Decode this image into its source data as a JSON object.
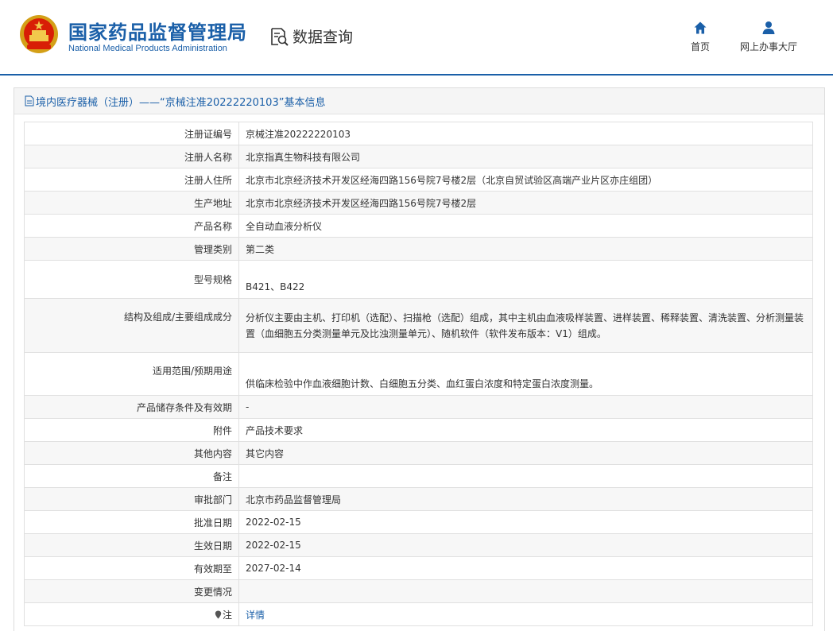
{
  "header": {
    "title_cn": "国家药品监督管理局",
    "title_en": "National Medical Products Administration",
    "query_label": "数据查询",
    "nav": [
      {
        "label": "首页",
        "icon": "home-icon"
      },
      {
        "label": "网上办事大厅",
        "icon": "user-icon"
      }
    ]
  },
  "panel": {
    "title": "境内医疗器械（注册）——“京械注准20222220103”基本信息"
  },
  "details": {
    "reg_no": {
      "label": "注册证编号",
      "value": "京械注准20222220103"
    },
    "registrant": {
      "label": "注册人名称",
      "value": "北京指真生物科技有限公司"
    },
    "registrant_address": {
      "label": "注册人住所",
      "value": "北京市北京经济技术开发区经海四路156号院7号楼2层（北京自贸试验区高端产业片区亦庄组团）"
    },
    "production_address": {
      "label": "生产地址",
      "value": "北京市北京经济技术开发区经海四路156号院7号楼2层"
    },
    "product_name": {
      "label": "产品名称",
      "value": "全自动血液分析仪"
    },
    "category": {
      "label": "管理类别",
      "value": "第二类"
    },
    "model": {
      "label": "型号规格",
      "value": "B421、B422"
    },
    "structure": {
      "label": "结构及组成/主要组成成分",
      "value": "分析仪主要由主机、打印机（选配）、扫描枪（选配）组成，其中主机由血液吸样装置、进样装置、稀释装置、清洗装置、分析测量装置（血细胞五分类测量单元及比浊测量单元）、随机软件（软件发布版本：V1）组成。"
    },
    "scope": {
      "label": "适用范围/预期用途",
      "value": "供临床检验中作血液细胞计数、白细胞五分类、血红蛋白浓度和特定蛋白浓度测量。"
    },
    "storage": {
      "label": "产品储存条件及有效期",
      "value": "-"
    },
    "attachment": {
      "label": "附件",
      "value": "产品技术要求"
    },
    "other": {
      "label": "其他内容",
      "value": "其它内容"
    },
    "remark": {
      "label": "备注",
      "value": ""
    },
    "approval_dept": {
      "label": "审批部门",
      "value": "北京市药品监督管理局"
    },
    "approval_date": {
      "label": "批准日期",
      "value": "2022-02-15"
    },
    "effective_date": {
      "label": "生效日期",
      "value": "2022-02-15"
    },
    "expiry_date": {
      "label": "有效期至",
      "value": "2027-02-14"
    },
    "change": {
      "label": "变更情况",
      "value": ""
    },
    "note": {
      "label": "注",
      "value": "详情"
    }
  },
  "colors": {
    "brand_blue": "#1a5fa8",
    "row_alt": "#f7f7f7",
    "border": "#e0e0e0"
  }
}
